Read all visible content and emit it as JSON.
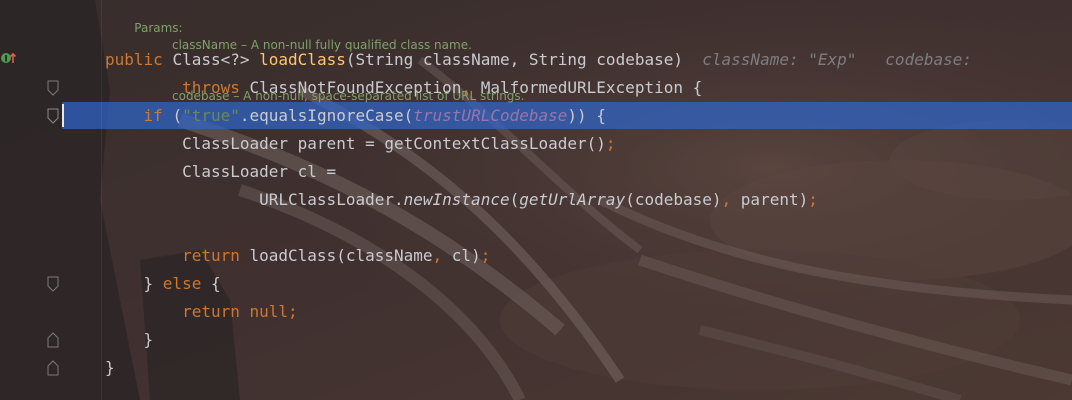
{
  "doc_comment": {
    "params_label": "Params:",
    "param1": "className – A non-null fully qualified class name.",
    "param2": "codebase – A non-null, space-separated list of URL strings."
  },
  "code": {
    "l1_public": "public ",
    "l1_class": "Class<?> ",
    "l1_method": "loadClass",
    "l1_args": "(String className, String codebase)",
    "l1_hint1": "className: \"Exp\"",
    "l1_hint2": "codebase:",
    "l2_throws": "throws ",
    "l2_ex1": "ClassNotFoundException",
    "l2_comma": ", ",
    "l2_ex2": "MalformedURLException {",
    "l3_if": "if ",
    "l3_paren": "(",
    "l3_str": "\"true\"",
    "l3_call": ".equalsIgnoreCase(",
    "l3_field": "trustURLCodebase",
    "l3_end": ")) {",
    "l4_text": "ClassLoader parent = getContextClassLoader()",
    "l4_semi": ";",
    "l5_text": "ClassLoader cl =",
    "l6_pre": "URLClassLoader.",
    "l6_newinst": "newInstance",
    "l6_open": "(",
    "l6_geturl": "getUrlArray",
    "l6_args": "(codebase)",
    "l6_comma": ", ",
    "l6_parent": "parent)",
    "l6_semi": ";",
    "l8_return": "return ",
    "l8_call": "loadClass(className",
    "l8_comma": ", ",
    "l8_cl": "cl)",
    "l8_semi": ";",
    "l9_brace": "} ",
    "l9_else": "else",
    "l9_open": " {",
    "l10_return": "return ",
    "l10_null": "null",
    "l10_semi": ";",
    "l11_brace": "}",
    "l12_brace": "}"
  },
  "colors": {
    "keyword": "#cc7832",
    "method": "#ffc66d",
    "string": "#6a8759",
    "field": "#9876aa",
    "selection": "#2f65ca",
    "doc": "#7fa16a"
  },
  "icons": {
    "override": "implements-marker-icon",
    "fold": "fold-marker-icon"
  }
}
